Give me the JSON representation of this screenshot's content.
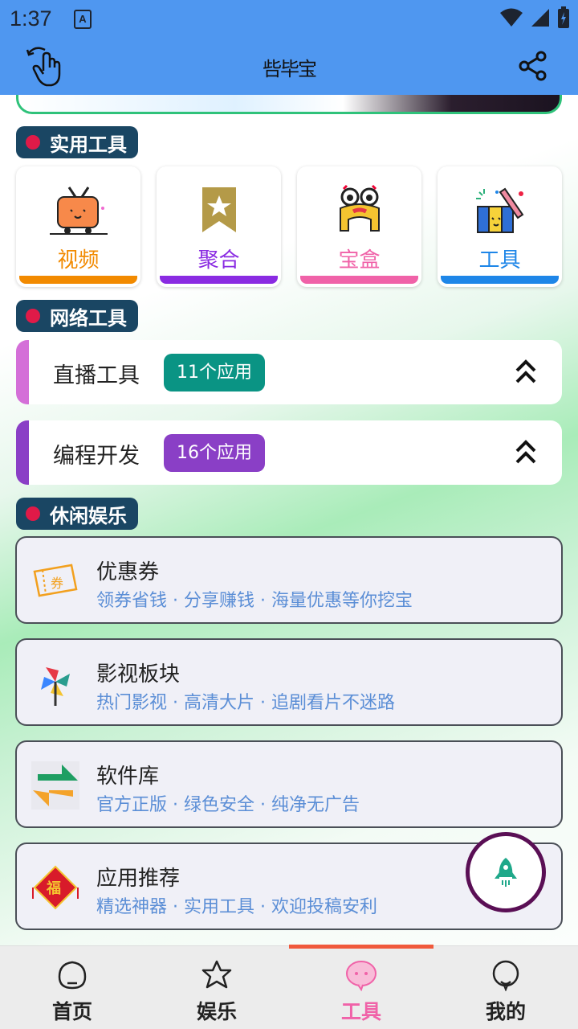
{
  "status_bar": {
    "time": "1:37",
    "input_indicator": "A"
  },
  "app_bar": {
    "title": "呰毕宝",
    "back_icon": "hand-pointer-icon",
    "share_icon": "share-icon"
  },
  "sections": {
    "practical": "实用工具",
    "network": "网络工具",
    "leisure": "休闲娱乐"
  },
  "tiles": [
    {
      "label": "视频",
      "color": "#f28a00",
      "bar": "#f28a00",
      "icon": "tv-icon"
    },
    {
      "label": "聚合",
      "color": "#8a2be2",
      "bar": "#8a2be2",
      "icon": "star-bookmark-icon"
    },
    {
      "label": "宝盒",
      "color": "#f062a8",
      "bar": "#f062a8",
      "icon": "treasure-box-icon"
    },
    {
      "label": "工具",
      "color": "#1e86e8",
      "bar": "#1e86e8",
      "icon": "gift-tools-icon"
    }
  ],
  "network_tools": [
    {
      "label": "直播工具",
      "badge": "11个应用",
      "stripe": "#d46fd8",
      "badge_color": "#0a9484"
    },
    {
      "label": "编程开发",
      "badge": "16个应用",
      "stripe": "#8a3fc6",
      "badge_color": "#8a3fc6"
    }
  ],
  "leisure_cards": [
    {
      "title": "优惠券",
      "subtitle": "领券省钱 · 分享赚钱 · 海量优惠等你挖宝",
      "icon": "coupon-icon"
    },
    {
      "title": "影视板块",
      "subtitle": "热门影视 · 高清大片 · 追剧看片不迷路",
      "icon": "pinwheel-icon"
    },
    {
      "title": "软件库",
      "subtitle": "官方正版 · 绿色安全 · 纯净无广告",
      "icon": "arrows-exchange-icon"
    },
    {
      "title": "应用推荐",
      "subtitle": "精选神器 · 实用工具 · 欢迎投稿安利",
      "icon": "fu-lantern-icon"
    }
  ],
  "coupon_char": "券",
  "fu_char": "福",
  "fab_icon": "rocket-icon",
  "bottom_nav": [
    {
      "label": "首页",
      "icon": "home-bubble-icon",
      "active": false
    },
    {
      "label": "娱乐",
      "icon": "star-bubble-icon",
      "active": false
    },
    {
      "label": "工具",
      "icon": "pig-bubble-icon",
      "active": true,
      "active_color": "#f062a8"
    },
    {
      "label": "我的",
      "icon": "profile-bubble-icon",
      "active": false
    }
  ]
}
